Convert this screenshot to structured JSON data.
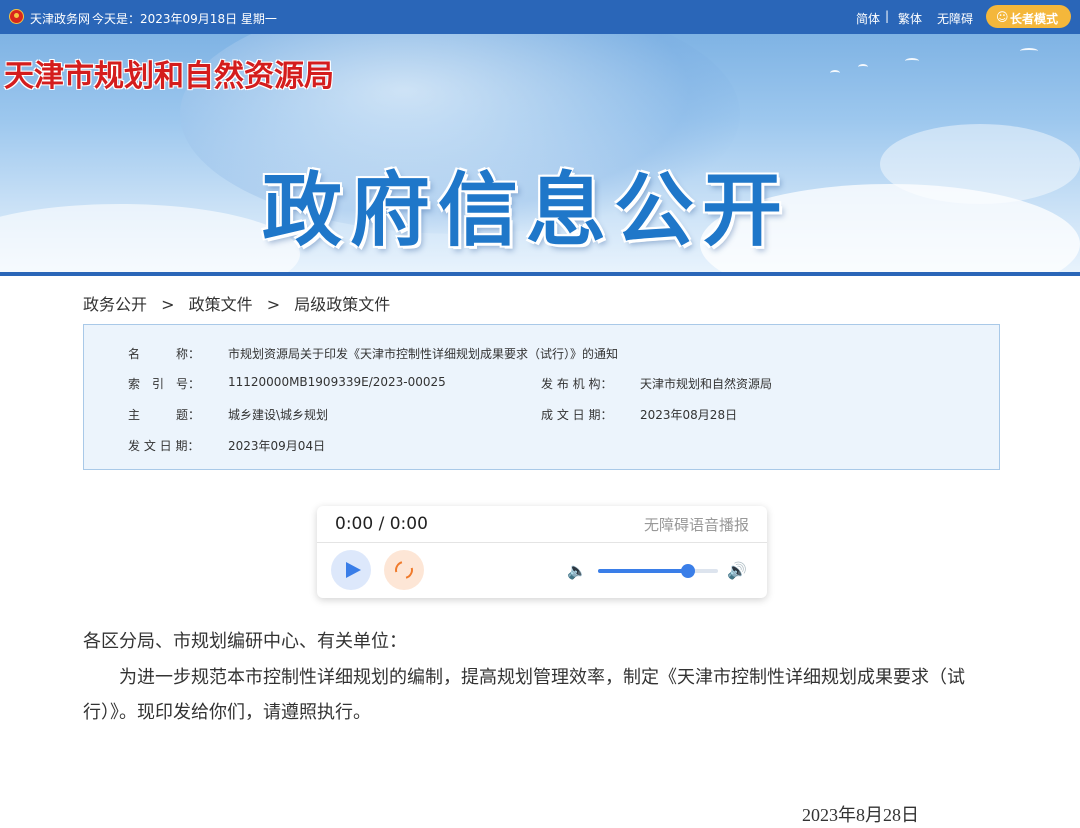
{
  "topbar": {
    "site_name": "天津政务网",
    "today": "今天是：2023年09月18日 星期一",
    "lang_simplified": "简体",
    "lang_traditional": "繁体",
    "accessibility": "无障碍",
    "separator": "|",
    "elder_mode": "长者模式",
    "emblem_icon": "national-emblem-icon"
  },
  "banner": {
    "agency_name": "天津市规划和自然资源局",
    "headline": "政府信息公开"
  },
  "breadcrumb": {
    "items": [
      "政务公开",
      "政策文件",
      "局级政策文件"
    ],
    "separator": ">"
  },
  "meta": {
    "name_label": "名　　　称：",
    "name_value": "市规划资源局关于印发《天津市控制性详细规划成果要求（试行）》的通知",
    "index_label": "索　引　号：",
    "index_value": "11120000MB1909339E/2023-00025",
    "issuer_label": "发 布 机 构：",
    "issuer_value": "天津市规划和自然资源局",
    "topic_label": "主　　　题：",
    "topic_value": "城乡建设\\城乡规划",
    "written_label": "成 文 日 期：",
    "written_value": "2023年08月28日",
    "publish_label": "发 文 日 期：",
    "publish_value": "2023年09月04日"
  },
  "player": {
    "time": "0:00 / 0:00",
    "title": "无障碍语音播报",
    "volume_percent": 75,
    "play_icon": "play-icon",
    "loop_icon": "loop-icon",
    "volume_low_icon": "volume-low-icon",
    "volume_high_icon": "volume-high-icon"
  },
  "document": {
    "salutation": "各区分局、市规划编研中心、有关单位：",
    "paragraph": "为进一步规范本市控制性详细规划的编制，提高规划管理效率，制定《天津市控制性详细规划成果要求（试行）》。现印发给你们，请遵照执行。",
    "date": "2023年8月28日"
  },
  "colors": {
    "topbar": "#2a66b8",
    "agency_red": "#d41d1d",
    "headline_blue": "#1f77c9",
    "elder_button": "#f4b73b",
    "accent_blue": "#3a7ee8",
    "accent_orange": "#f07a2b"
  }
}
